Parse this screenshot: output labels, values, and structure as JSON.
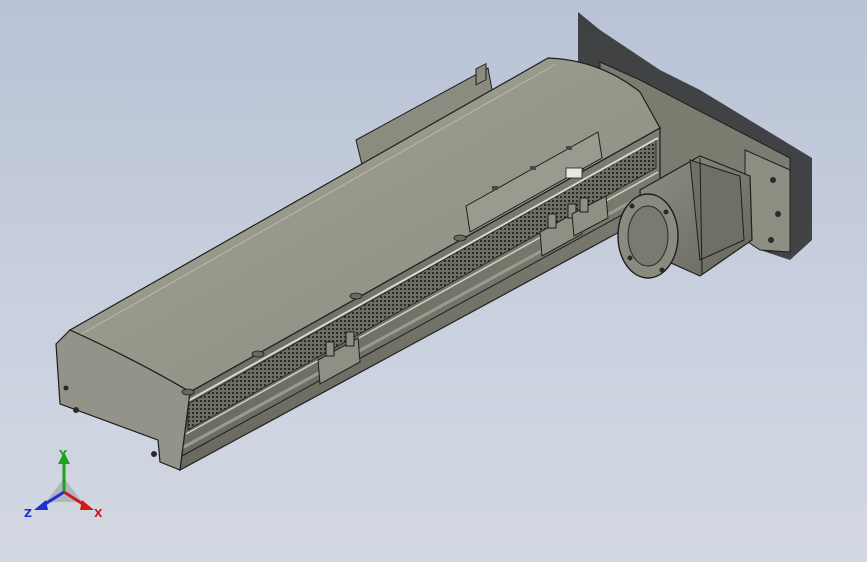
{
  "viewport": {
    "background_top": "#b9c3d6",
    "background_bottom": "#d3d8e2"
  },
  "model": {
    "body_color": "#8c8c80",
    "edge_color": "#1e1e1e",
    "motor_color": "#77776d"
  },
  "triad": {
    "y_label": "Y",
    "x_label": "X",
    "z_label": "Z",
    "y_color": "#1fa01f",
    "x_color": "#d01a1a",
    "z_color": "#2030d0"
  }
}
